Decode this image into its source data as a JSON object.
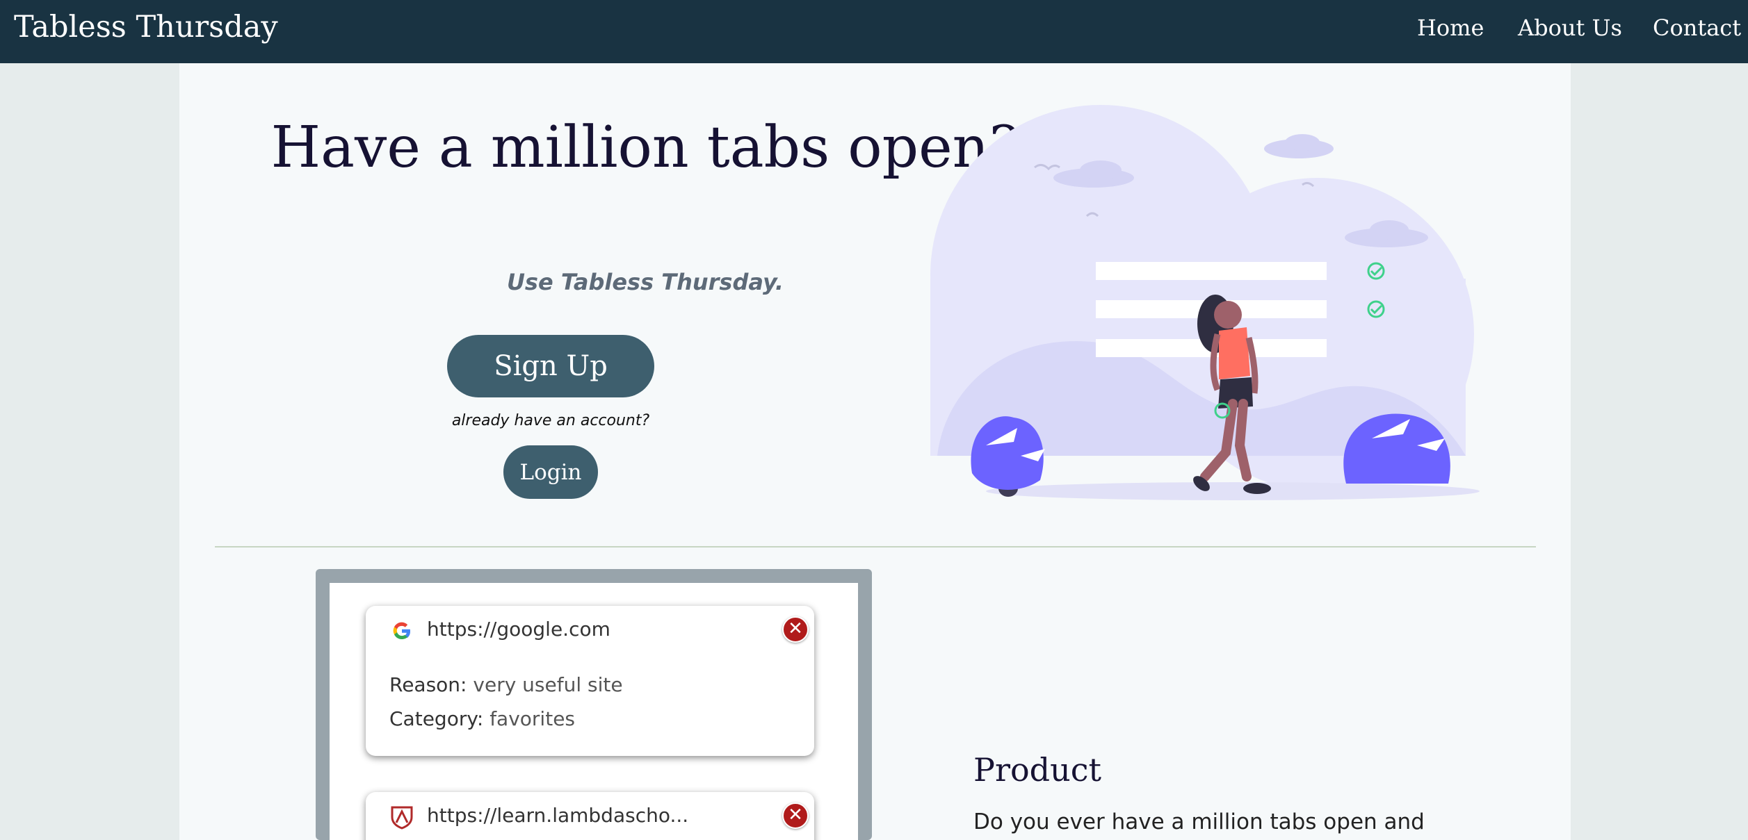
{
  "nav": {
    "brand": "Tabless Thursday",
    "links": [
      "Home",
      "About Us",
      "Contact"
    ]
  },
  "hero": {
    "title": "Have a million tabs open?",
    "tagline": "Use Tabless Thursday.",
    "signup_label": "Sign Up",
    "already_text": "already have an account?",
    "login_label": "Login"
  },
  "demo": {
    "tabs": [
      {
        "url": "https://google.com",
        "reason_key": "Reason:",
        "reason_val": "very useful site",
        "category_key": "Category:",
        "category_val": "favorites",
        "icon": "google-icon",
        "close": "✕"
      },
      {
        "url": "https://learn.lambdascho...",
        "icon": "lambda-shield-icon",
        "close": "✕"
      }
    ]
  },
  "product": {
    "title": "Product",
    "text": "Do you ever have a million tabs open and"
  },
  "colors": {
    "navbar": "#193342",
    "button": "#3e5f6e",
    "accent_purple": "#6c63ff",
    "close_red": "#b01b1b"
  }
}
